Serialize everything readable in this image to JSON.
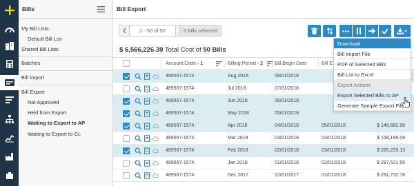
{
  "sidebar": {
    "title": "Bills",
    "items": [
      {
        "label": "My Bill Lists"
      },
      {
        "label": "Default Bill List"
      },
      {
        "label": "Shared Bill Lists"
      },
      {
        "label": "Batches"
      },
      {
        "label": "Bill Import"
      },
      {
        "label": "Bill Export"
      },
      {
        "label": "Not Approved"
      },
      {
        "label": "Held from Export"
      },
      {
        "label": "Waiting to Export to AP"
      },
      {
        "label": "Waiting to Export to GL"
      }
    ]
  },
  "main": {
    "title": "Bill Export",
    "pager": {
      "range": "1 - 50 of 50"
    },
    "selected_badge": "5 bills selected",
    "summary": {
      "amount": "$ 6,566,226.39",
      "text": "Total Cost of",
      "count": "50 Bills"
    },
    "columns": {
      "account": "Account Code",
      "account_sort": "- 1",
      "billing": "Billing Period",
      "billing_sort": "- 2",
      "begin": "Bill Begin Date",
      "end": "Bill E"
    },
    "rows": [
      {
        "account": "489567-1574",
        "period": "Aug 2018",
        "begin": "08/01/2018",
        "end": "",
        "amount": ""
      },
      {
        "account": "489567-1574",
        "period": "Jul 2018",
        "begin": "07/01/2018",
        "end": "",
        "amount": ""
      },
      {
        "account": "489567-1574",
        "period": "Jun 2018",
        "begin": "06/01/2018",
        "end": "",
        "amount": ""
      },
      {
        "account": "489567-1574",
        "period": "May 2018",
        "begin": "05/01/2018",
        "end": "",
        "amount": ""
      },
      {
        "account": "489567-1574",
        "period": "Apr 2018",
        "begin": "04/01/2018",
        "end": "05/01/2018",
        "amount": "$ 148,682.98"
      },
      {
        "account": "489567-1574",
        "period": "Mar 2018",
        "begin": "03/01/2018",
        "end": "04/01/2018",
        "amount": "$ 158,199.09"
      },
      {
        "account": "489567-1574",
        "period": "Feb 2018",
        "begin": "02/01/2018",
        "end": "03/01/2018",
        "amount": "$ 265,233.13"
      },
      {
        "account": "489567-1574",
        "period": "Jan 2018",
        "begin": "01/01/2018",
        "end": "02/01/2018",
        "amount": "$ 297,521.55"
      },
      {
        "account": "489567-1574",
        "period": "Dec 2017",
        "begin": "12/01/2017",
        "end": "01/01/2018",
        "amount": "$ 291,732.78"
      }
    ]
  },
  "dropdown": {
    "items": [
      {
        "label": "Download",
        "kind": "header-blue"
      },
      {
        "label": "Bill Import File",
        "kind": "item"
      },
      {
        "label": "PDF of Selected Bills",
        "kind": "item"
      },
      {
        "label": "Bill List to Excel",
        "kind": "item"
      },
      {
        "label": "Export Actions",
        "kind": "header-gray"
      },
      {
        "label": "Export Selected Bills to AP",
        "kind": "highlight"
      },
      {
        "label": "Generate Sample Export File",
        "kind": "item"
      }
    ]
  },
  "colors": {
    "rail_bg": "#1f3447",
    "accent": "#2e89c2",
    "selected_row": "#daecf1",
    "logo_yellow": "#f5d31a"
  },
  "icons": [
    "plus-icon",
    "gauge-icon",
    "buildings-icon",
    "calculator-icon",
    "bills-icon",
    "lines-icon",
    "org-chart-icon",
    "chart-line-icon",
    "factory-icon",
    "trash-icon",
    "sort-icon",
    "more-icon",
    "pause-icon",
    "arrow-right-icon",
    "check-icon",
    "download-icon"
  ]
}
